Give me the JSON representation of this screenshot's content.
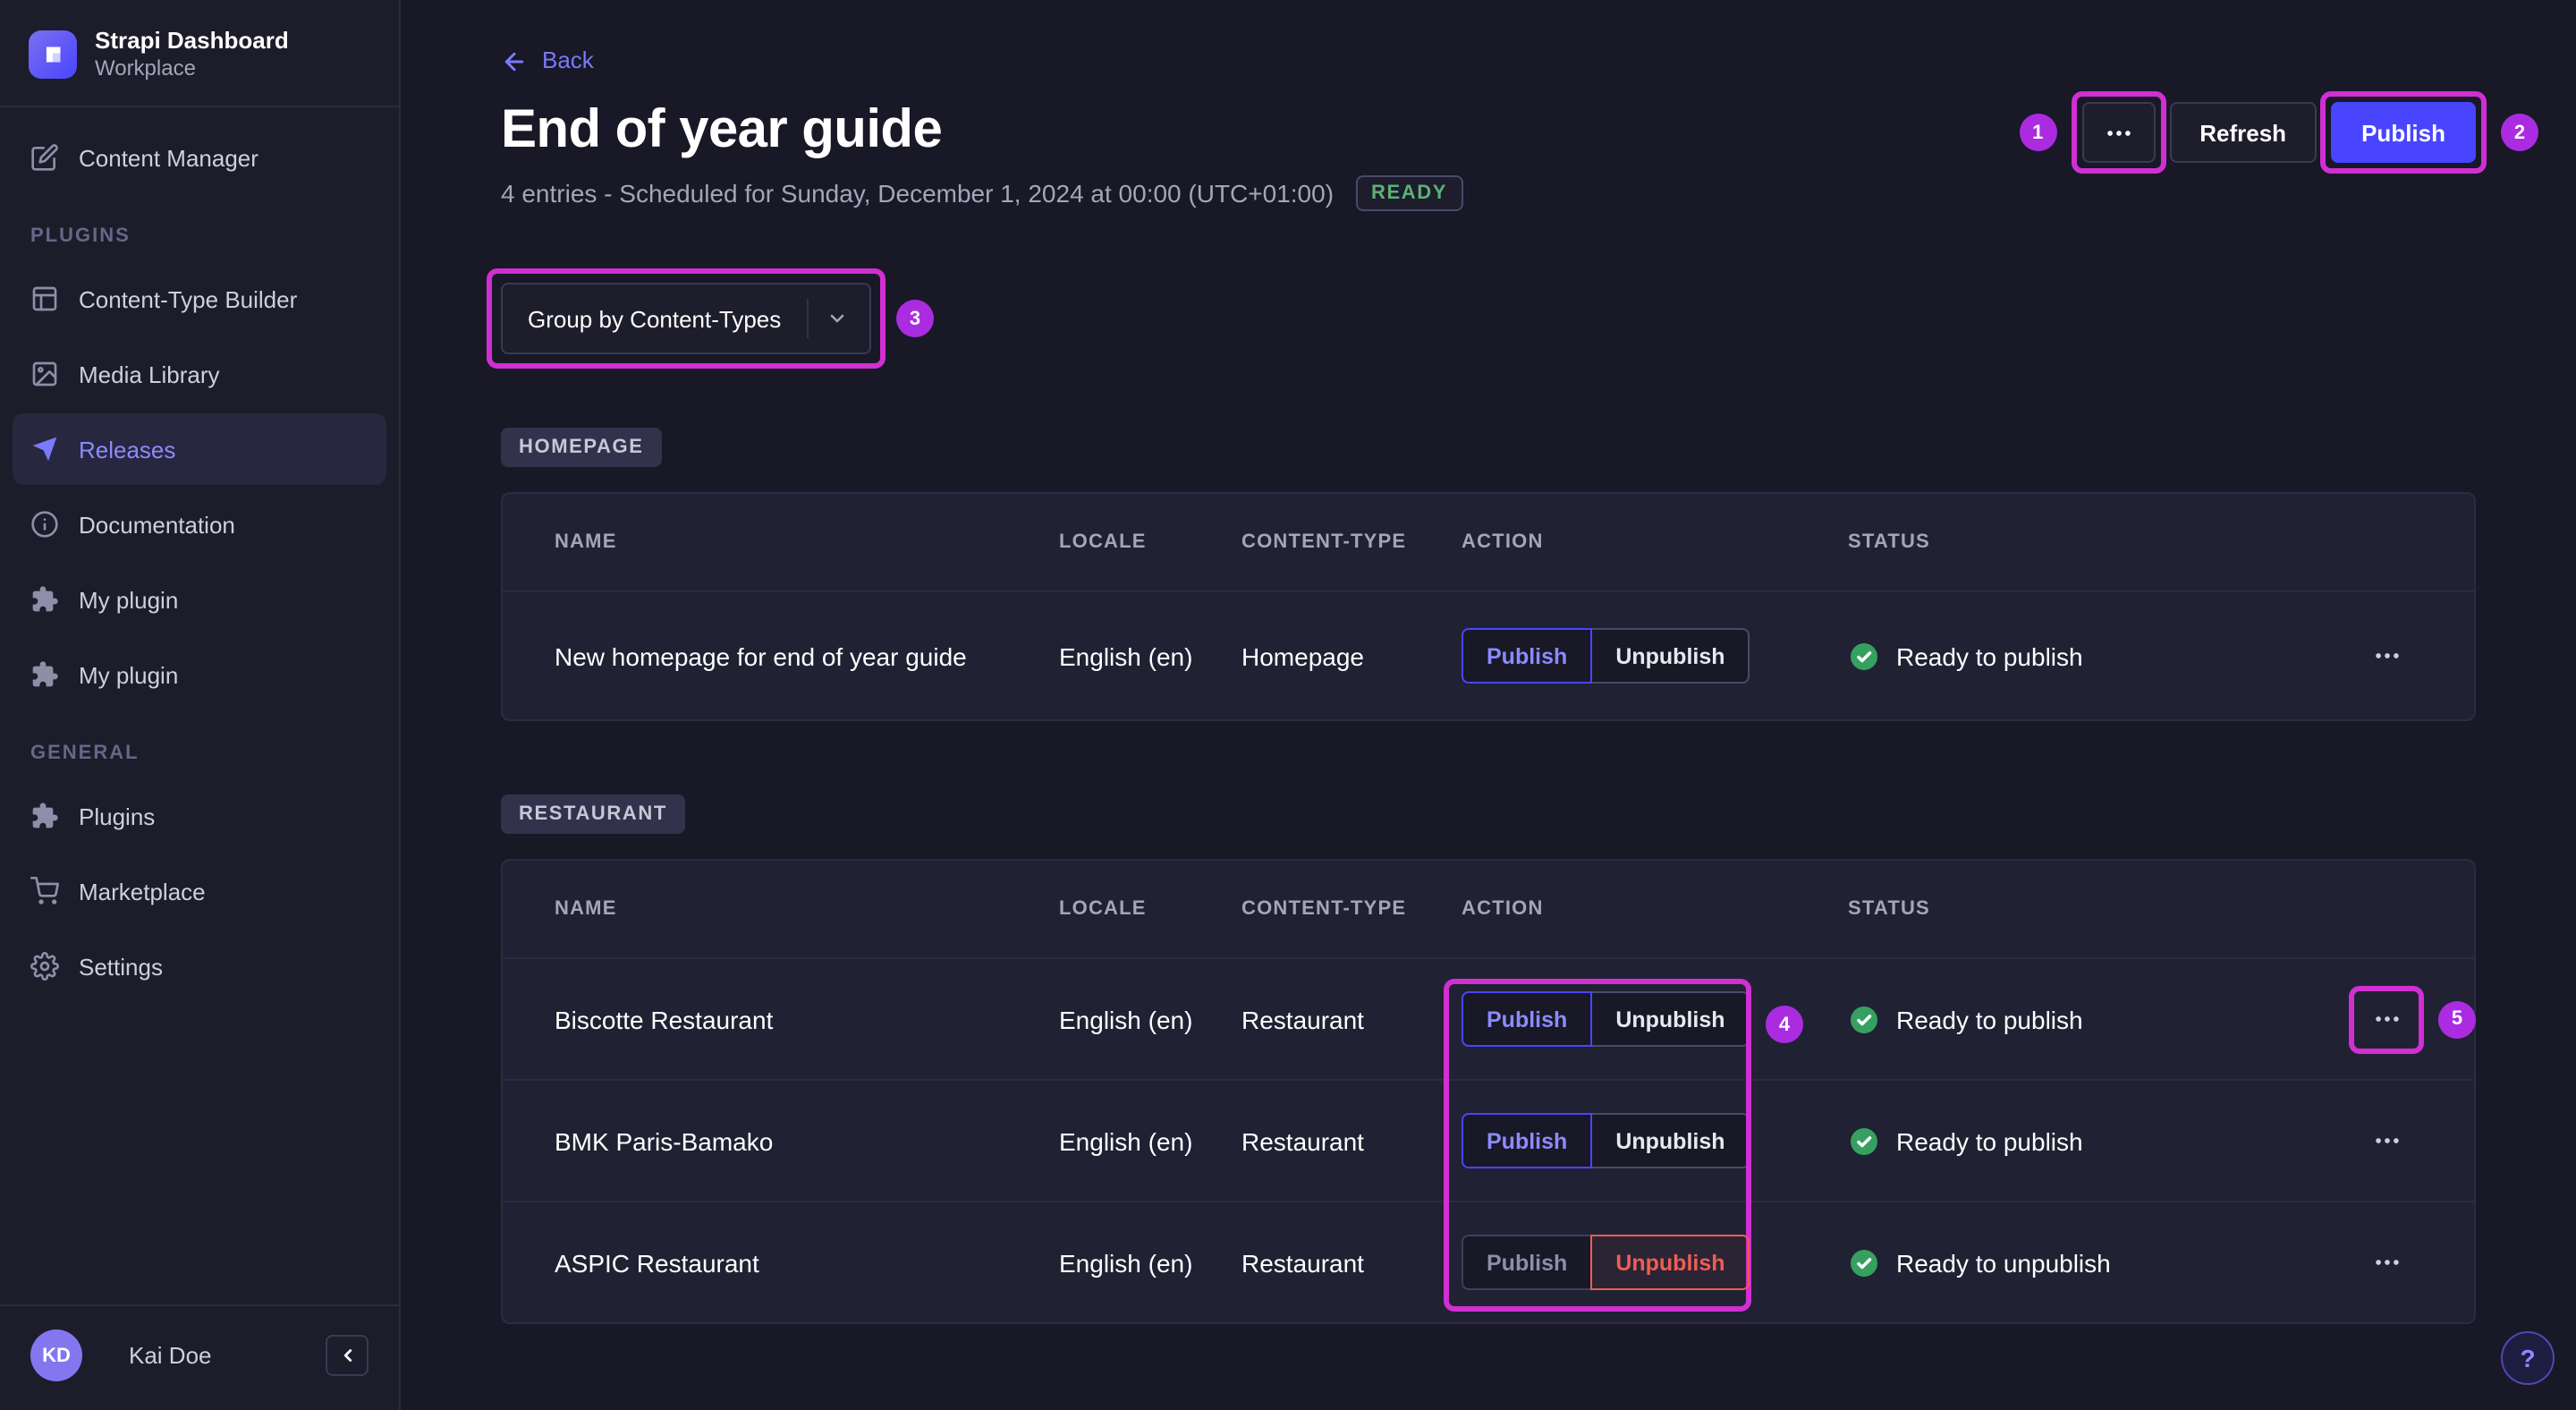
{
  "colors": {
    "accent": "#4945ff",
    "accent_light": "#7b79ff",
    "success": "#5cb176",
    "danger": "#ee5e52",
    "annotation_box": "#d02fd2",
    "annotation_badge": "#ab2ce0"
  },
  "sidebar": {
    "brand": {
      "title": "Strapi Dashboard",
      "subtitle": "Workplace"
    },
    "content_manager": {
      "label": "Content Manager"
    },
    "plugins": {
      "label": "PLUGINS",
      "items": [
        {
          "label": "Content-Type Builder"
        },
        {
          "label": "Media Library"
        },
        {
          "label": "Releases"
        },
        {
          "label": "Documentation"
        },
        {
          "label": "My plugin"
        },
        {
          "label": "My plugin"
        }
      ]
    },
    "general": {
      "label": "GENERAL",
      "items": [
        {
          "label": "Plugins"
        },
        {
          "label": "Marketplace"
        },
        {
          "label": "Settings"
        }
      ]
    },
    "user": {
      "initials": "KD",
      "name": "Kai Doe"
    }
  },
  "header": {
    "back": "Back",
    "title": "End of year guide",
    "subtitle": "4 entries - Scheduled for Sunday, December 1, 2024 at 00:00 (UTC+01:00)",
    "status": "READY",
    "refresh": "Refresh",
    "publish": "Publish"
  },
  "toolbar": {
    "group_by": "Group by Content-Types"
  },
  "groups": [
    {
      "badge": "HOMEPAGE",
      "columns": [
        "NAME",
        "LOCALE",
        "CONTENT-TYPE",
        "ACTION",
        "STATUS"
      ],
      "rows": [
        {
          "name": "New homepage for end of year guide",
          "locale": "English (en)",
          "content_type": "Homepage",
          "publish": "Publish",
          "unpublish": "Unpublish",
          "status": "Ready to publish"
        }
      ]
    },
    {
      "badge": "RESTAURANT",
      "columns": [
        "NAME",
        "LOCALE",
        "CONTENT-TYPE",
        "ACTION",
        "STATUS"
      ],
      "rows": [
        {
          "name": "Biscotte Restaurant",
          "locale": "English (en)",
          "content_type": "Restaurant",
          "publish": "Publish",
          "unpublish": "Unpublish",
          "status": "Ready to publish"
        },
        {
          "name": "BMK Paris-Bamako",
          "locale": "English (en)",
          "content_type": "Restaurant",
          "publish": "Publish",
          "unpublish": "Unpublish",
          "status": "Ready to publish"
        },
        {
          "name": "ASPIC Restaurant",
          "locale": "English (en)",
          "content_type": "Restaurant",
          "publish": "Publish",
          "unpublish": "Unpublish",
          "status": "Ready to unpublish"
        }
      ]
    }
  ],
  "annotations": {
    "n1": "1",
    "n2": "2",
    "n3": "3",
    "n4": "4",
    "n5": "5"
  },
  "help": {
    "label": "?"
  }
}
